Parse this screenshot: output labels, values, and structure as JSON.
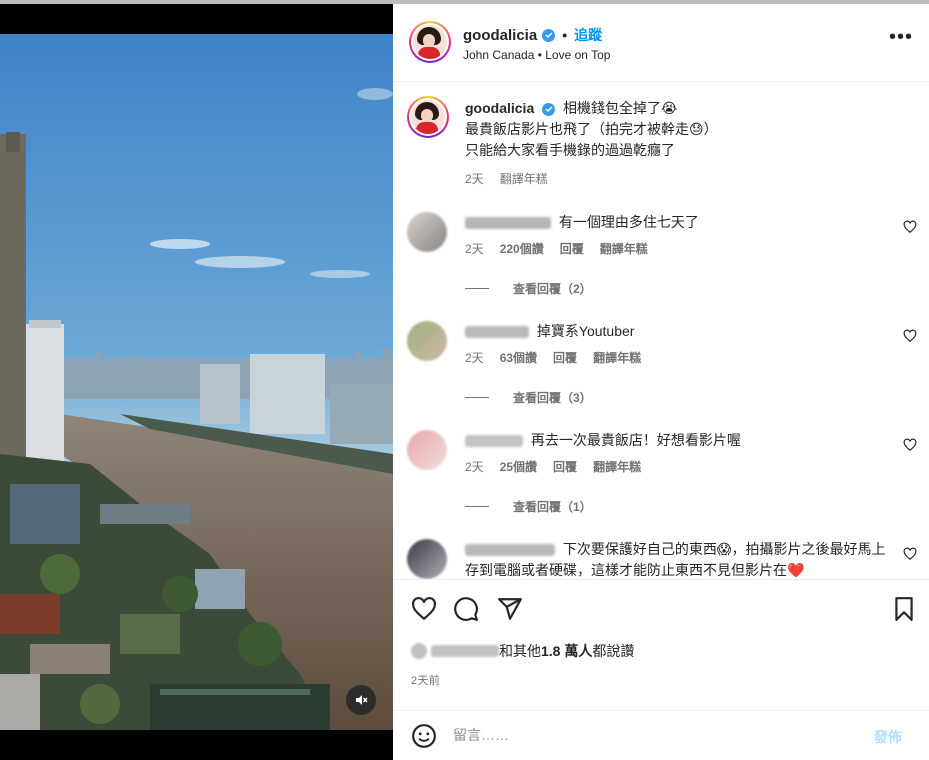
{
  "header": {
    "username": "goodalicia",
    "follow_label": "追蹤",
    "subtitle": "John Canada • Love on Top"
  },
  "caption": {
    "username": "goodalicia",
    "lines": [
      "相機錢包全掉了😭",
      "最貴飯店影片也飛了（拍完才被幹走😓）",
      "只能給大家看手機錄的過過乾癮了"
    ],
    "time": "2天",
    "translate": "翻譯年糕"
  },
  "comments": [
    {
      "text": "有一個理由多住七天了",
      "time": "2天",
      "likes": "220個讚",
      "reply": "回覆",
      "translate": "翻譯年糕",
      "replies": "查看回覆（2）"
    },
    {
      "text": "掉寶系Youtuber",
      "time": "2天",
      "likes": "63個讚",
      "reply": "回覆",
      "translate": "翻譯年糕",
      "replies": "查看回覆（3）"
    },
    {
      "text": "再去一次最貴飯店！好想看影片喔",
      "time": "2天",
      "likes": "25個讚",
      "reply": "回覆",
      "translate": "翻譯年糕",
      "replies": "查看回覆（1）"
    },
    {
      "text": "下次要保護好自己的東西😱，拍攝影片之後最好馬上存到電腦或者硬碟，這樣才能防止東西不見但影片在❤️"
    }
  ],
  "likes": {
    "suffix": "和其他",
    "count": "1.8 萬人",
    "tail": "都說讚"
  },
  "timestamp": "2天前",
  "comment_box": {
    "placeholder": "留言……",
    "post_label": "發佈"
  },
  "colors": {
    "accent": "#0095f6",
    "verified": "#3897f0",
    "post_disabled": "#b2dffc",
    "heart_red": "#ed4956"
  },
  "icons": [
    "verified-badge-icon",
    "more-options-icon",
    "heart-icon",
    "comment-icon",
    "share-icon",
    "save-icon",
    "emoji-icon",
    "mute-icon"
  ]
}
